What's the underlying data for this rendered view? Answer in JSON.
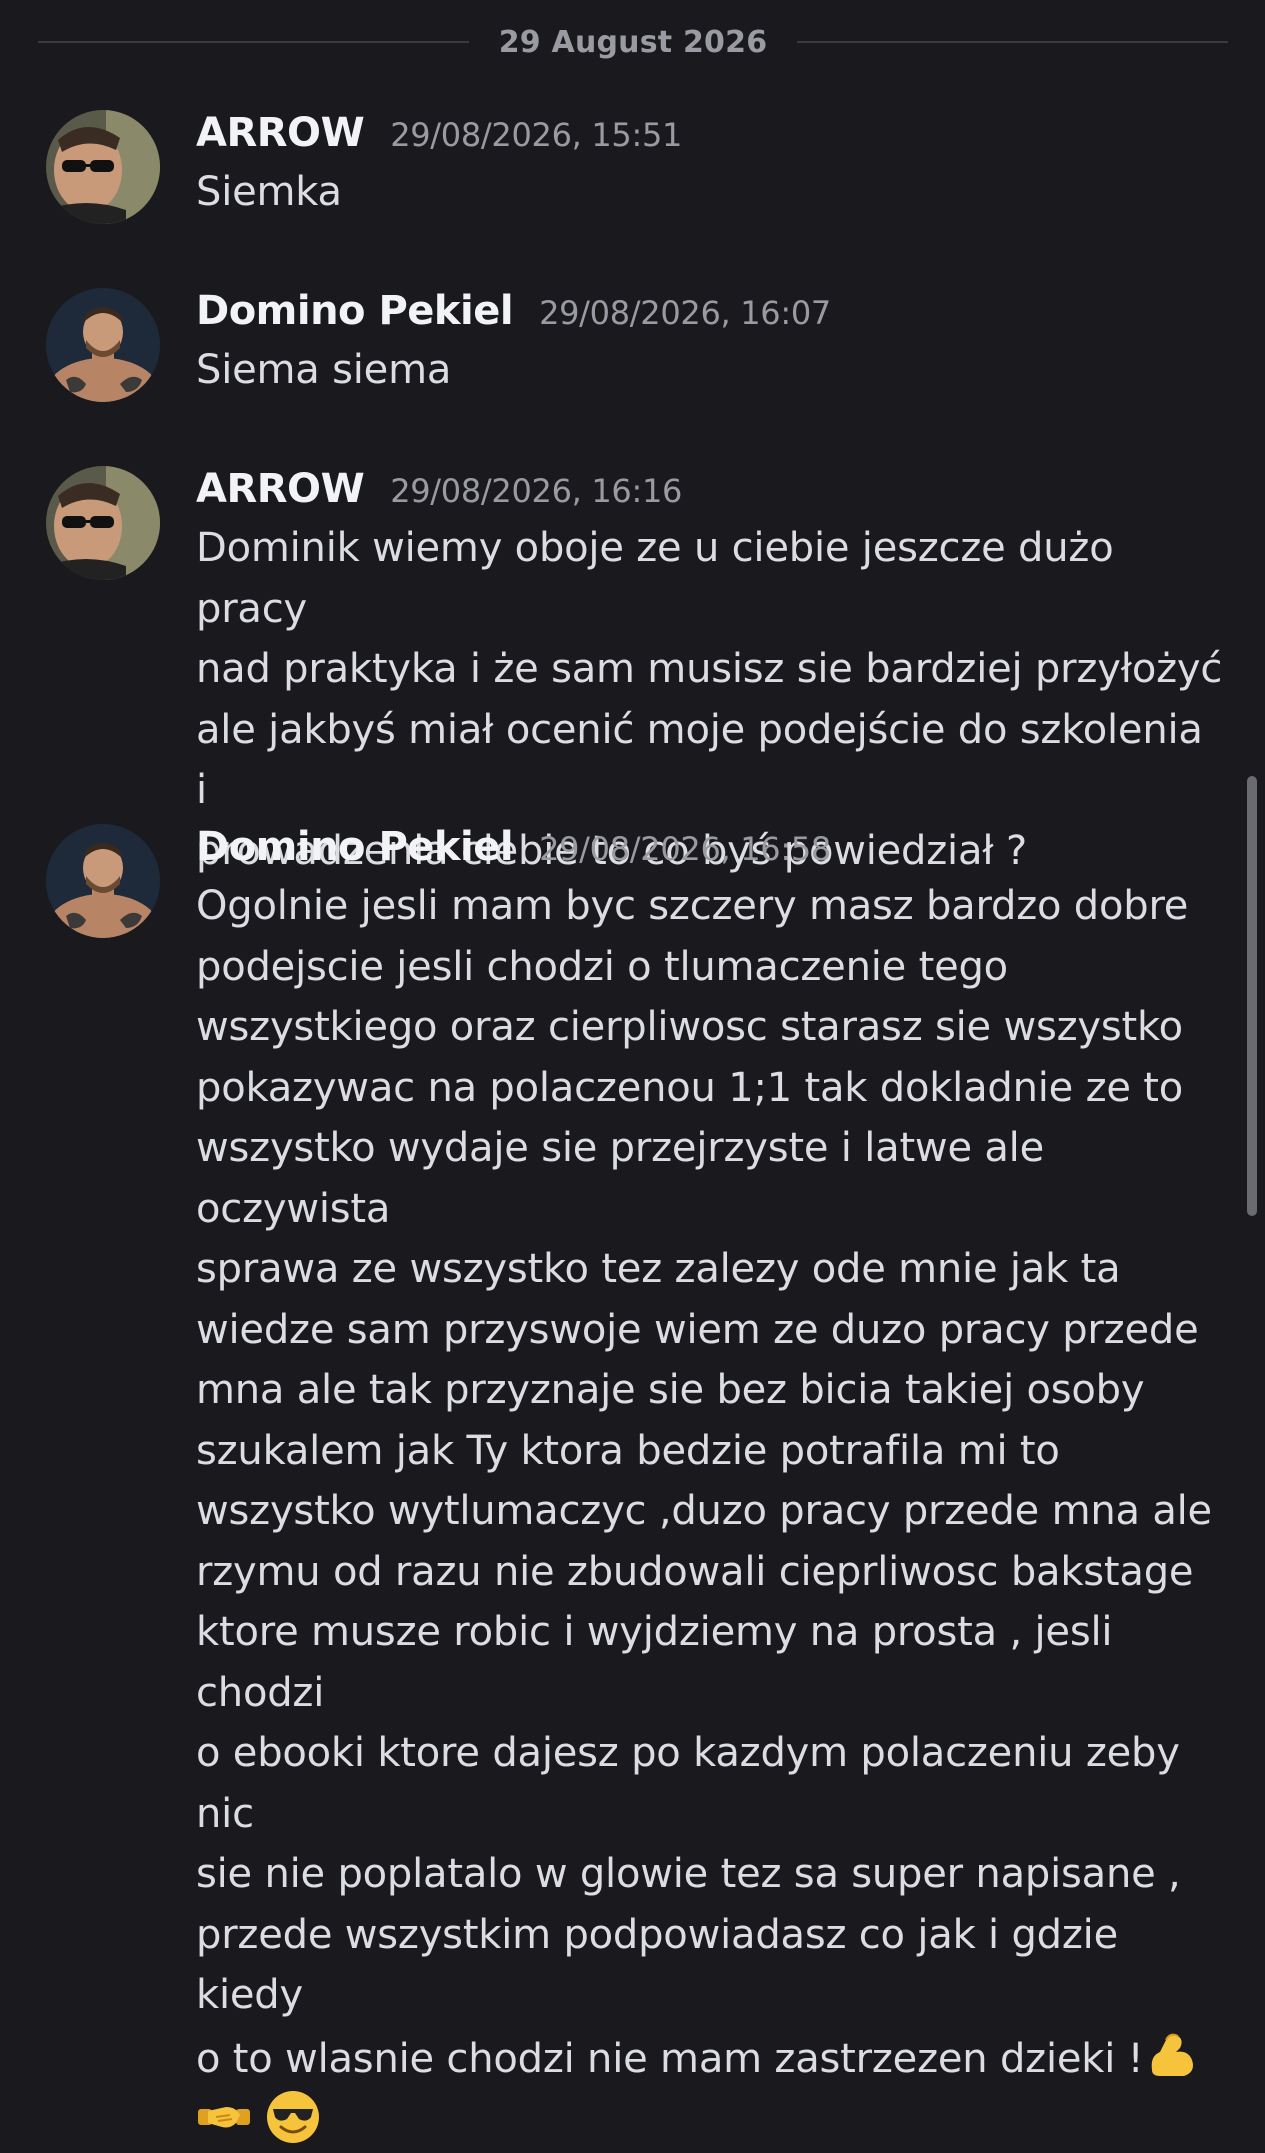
{
  "date_divider": "29 August 2026",
  "messages": [
    {
      "username": "ARROW",
      "timestamp": "29/08/2026, 15:51",
      "text": "Siemka",
      "avatar": "arrow-avatar"
    },
    {
      "username": "Domino Pekiel",
      "timestamp": "29/08/2026, 16:07",
      "text": "Siema siema",
      "avatar": "domino-avatar"
    },
    {
      "username": "ARROW",
      "timestamp": "29/08/2026, 16:16",
      "text": "Dominik wiemy oboje ze u ciebie jeszcze dużo pracy\nnad praktyka i że sam musisz sie bardziej przyłożyć\nale jakbyś miał ocenić moje podejście do szkolenia i\nprowadzenia ciebie to co byś powiedział ?",
      "avatar": "arrow-avatar"
    },
    {
      "username": "Domino Pekiel",
      "timestamp": "29/08/2026, 16:58",
      "text": "Ogolnie jesli mam byc szczery  masz bardzo dobre\npodejscie jesli chodzi o tlumaczenie tego\nwszystkiego oraz cierpliwosc starasz sie wszystko\npokazywac na polaczenou 1;1 tak dokladnie ze to\nwszystko wydaje sie przejrzyste i latwe ale oczywista\nsprawa ze wszystko tez zalezy ode mnie jak ta\nwiedze sam przyswoje wiem ze duzo pracy przede\nmna ale tak przyznaje sie bez bicia takiej osoby\nszukalem jak Ty ktora bedzie potrafila mi to\nwszystko wytlumaczyc ,duzo pracy przede mna ale\nrzymu od razu nie zbudowali cieprliwosc bakstage\nktore musze robic i wyjdziemy na prosta , jesli chodzi\no ebooki ktore dajesz po kazdym polaczeniu zeby nic\nsie nie poplatalo w glowie tez sa super napisane ,\nprzede wszystkim podpowiadasz co jak i gdzie kiedy\no to wlasnie chodzi nie mam zastrzezen dzieki !",
      "avatar": "domino-avatar",
      "trailing_emojis": [
        "flexed-biceps-emoji",
        "handshake-emoji",
        "sunglasses-smiley-emoji"
      ]
    }
  ]
}
